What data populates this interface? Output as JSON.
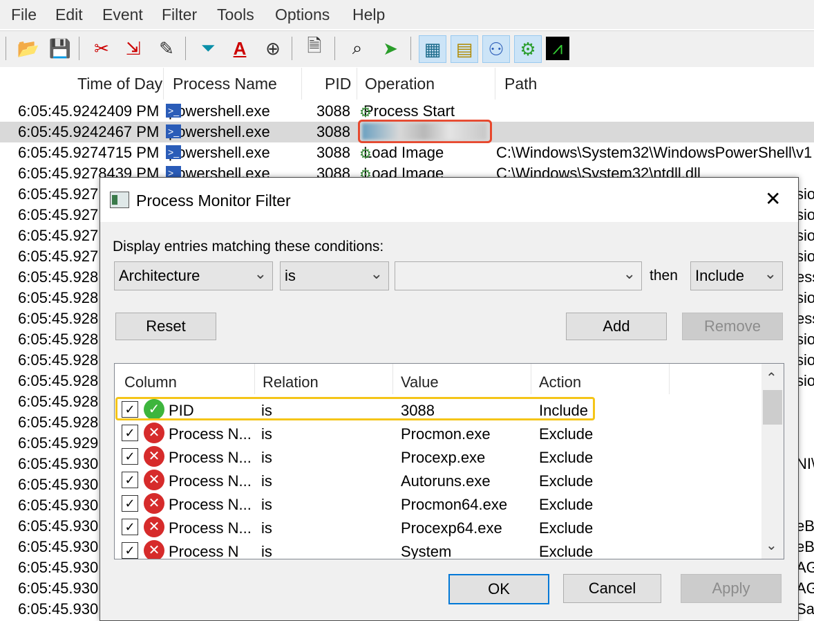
{
  "menu": [
    "File",
    "Edit",
    "Event",
    "Filter",
    "Tools",
    "Options",
    "Help"
  ],
  "toolbar_icons": [
    "open-icon",
    "save-icon",
    "capture-icon",
    "autoscroll-icon",
    "clear-icon",
    "filter-icon",
    "highlight-icon",
    "target-icon",
    "properties-icon",
    "find-icon",
    "jump-icon",
    "registry-activity-icon",
    "filesystem-activity-icon",
    "network-activity-icon",
    "process-activity-icon",
    "profiling-activity-icon"
  ],
  "columns": [
    "Time of Day",
    "Process Name",
    "PID",
    "Operation",
    "Path"
  ],
  "rows": [
    {
      "time": "6:05:45.9242409 PM",
      "process": "powershell.exe",
      "pid": "3088",
      "operation": "Process Start",
      "path": ""
    },
    {
      "time": "6:05:45.9242467 PM",
      "process": "powershell.exe",
      "pid": "3088",
      "operation": "",
      "path": ""
    },
    {
      "time": "6:05:45.9274715 PM",
      "process": "powershell.exe",
      "pid": "3088",
      "operation": "Load Image",
      "path": "C:\\Windows\\System32\\WindowsPowerShell\\v1"
    },
    {
      "time": "6:05:45.9278439 PM",
      "process": "powershell.exe",
      "pid": "3088",
      "operation": "Load Image",
      "path": "C:\\Windows\\System32\\ntdll.dll"
    },
    {
      "time": "6:05:45.927",
      "right": "sio"
    },
    {
      "time": "6:05:45.927",
      "right": "sio"
    },
    {
      "time": "6:05:45.927",
      "right": "sio"
    },
    {
      "time": "6:05:45.927",
      "right": "sio"
    },
    {
      "time": "6:05:45.928",
      "right": "ess"
    },
    {
      "time": "6:05:45.928",
      "right": "sio"
    },
    {
      "time": "6:05:45.928",
      "right": "ess"
    },
    {
      "time": "6:05:45.928",
      "right": "sio"
    },
    {
      "time": "6:05:45.928",
      "right": "sio"
    },
    {
      "time": "6:05:45.928",
      "right": "sio"
    },
    {
      "time": "6:05:45.928",
      "right": ""
    },
    {
      "time": "6:05:45.928",
      "right": ""
    },
    {
      "time": "6:05:45.929",
      "right": ""
    },
    {
      "time": "6:05:45.930",
      "right": "NI\\S"
    },
    {
      "time": "6:05:45.930",
      "right": ""
    },
    {
      "time": "6:05:45.930",
      "right": ""
    },
    {
      "time": "6:05:45.930",
      "right": "eBo"
    },
    {
      "time": "6:05:45.930",
      "right": "eBo"
    },
    {
      "time": "6:05:45.930",
      "right": "AGI"
    },
    {
      "time": "6:05:45.930",
      "right": "AGI"
    },
    {
      "time": "6:05:45.930",
      "right": "Sa"
    }
  ],
  "dialog": {
    "title": "Process Monitor Filter",
    "close": "✕",
    "instruction": "Display entries matching these conditions:",
    "column_combo": "Architecture",
    "relation_combo": "is",
    "value_combo": "",
    "then_label": "then",
    "action_combo": "Include",
    "reset": "Reset",
    "add": "Add",
    "remove": "Remove",
    "list_headers": [
      "Column",
      "Relation",
      "Value",
      "Action"
    ],
    "rules": [
      {
        "checked": true,
        "type": "include",
        "column": "PID",
        "relation": "is",
        "value": "3088",
        "action": "Include"
      },
      {
        "checked": true,
        "type": "exclude",
        "column": "Process N...",
        "relation": "is",
        "value": "Procmon.exe",
        "action": "Exclude"
      },
      {
        "checked": true,
        "type": "exclude",
        "column": "Process N...",
        "relation": "is",
        "value": "Procexp.exe",
        "action": "Exclude"
      },
      {
        "checked": true,
        "type": "exclude",
        "column": "Process N...",
        "relation": "is",
        "value": "Autoruns.exe",
        "action": "Exclude"
      },
      {
        "checked": true,
        "type": "exclude",
        "column": "Process N...",
        "relation": "is",
        "value": "Procmon64.exe",
        "action": "Exclude"
      },
      {
        "checked": true,
        "type": "exclude",
        "column": "Process N...",
        "relation": "is",
        "value": "Procexp64.exe",
        "action": "Exclude"
      },
      {
        "checked": true,
        "type": "exclude",
        "column": "Process N",
        "relation": "is",
        "value": "System",
        "action": "Exclude"
      }
    ],
    "ok": "OK",
    "cancel": "Cancel",
    "apply": "Apply"
  },
  "colors": {
    "highlight_red": "#e8472c",
    "highlight_yellow": "#f5c518",
    "accent": "#0078d7"
  }
}
